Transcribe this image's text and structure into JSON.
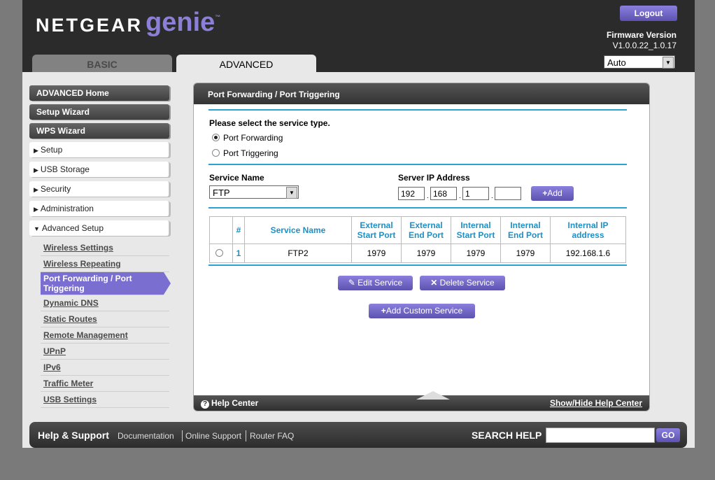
{
  "header": {
    "brand": "NETGEAR",
    "product": "genie",
    "trademark": "™",
    "logout_label": "Logout",
    "firmware_label": "Firmware Version",
    "firmware_value": "V1.0.0.22_1.0.17",
    "language": "Auto"
  },
  "tabs": {
    "basic": "BASIC",
    "advanced": "ADVANCED"
  },
  "nav": {
    "advanced_home": "ADVANCED Home",
    "setup_wizard": "Setup Wizard",
    "wps_wizard": "WPS Wizard",
    "setup": "Setup",
    "usb_storage": "USB Storage",
    "security": "Security",
    "administration": "Administration",
    "advanced_setup": "Advanced Setup",
    "sub": {
      "wireless_settings": "Wireless Settings",
      "wireless_repeating": "Wireless Repeating",
      "port_forwarding": "Port Forwarding / Port Triggering",
      "dynamic_dns": "Dynamic DNS",
      "static_routes": "Static Routes",
      "remote_management": "Remote Management",
      "upnp": "UPnP",
      "ipv6": "IPv6",
      "traffic_meter": "Traffic Meter",
      "usb_settings": "USB Settings"
    }
  },
  "panel": {
    "title": "Port Forwarding / Port Triggering",
    "select_prompt": "Please select the service type.",
    "opt_forwarding": "Port Forwarding",
    "opt_triggering": "Port Triggering",
    "service_name_label": "Service Name",
    "service_name_value": "FTP",
    "server_ip_label": "Server IP Address",
    "ip": [
      "192",
      "168",
      "1",
      ""
    ],
    "add_label": "Add",
    "table": {
      "headers": [
        "",
        "#",
        "Service Name",
        "External Start Port",
        "External End Port",
        "Internal Start Port",
        "Internal End Port",
        "Internal IP address"
      ],
      "rows": [
        {
          "num": "1",
          "name": "FTP2",
          "ext_start": "1979",
          "ext_end": "1979",
          "int_start": "1979",
          "int_end": "1979",
          "ip": "192.168.1.6"
        }
      ]
    },
    "edit_label": "Edit Service",
    "delete_label": "Delete Service",
    "add_custom_label": "Add Custom Service",
    "help_center": "Help Center",
    "show_hide": "Show/Hide Help Center"
  },
  "footer": {
    "help_support": "Help & Support",
    "documentation": "Documentation",
    "online_support": "Online Support",
    "router_faq": "Router FAQ",
    "search_help": "SEARCH HELP",
    "go": "GO"
  }
}
